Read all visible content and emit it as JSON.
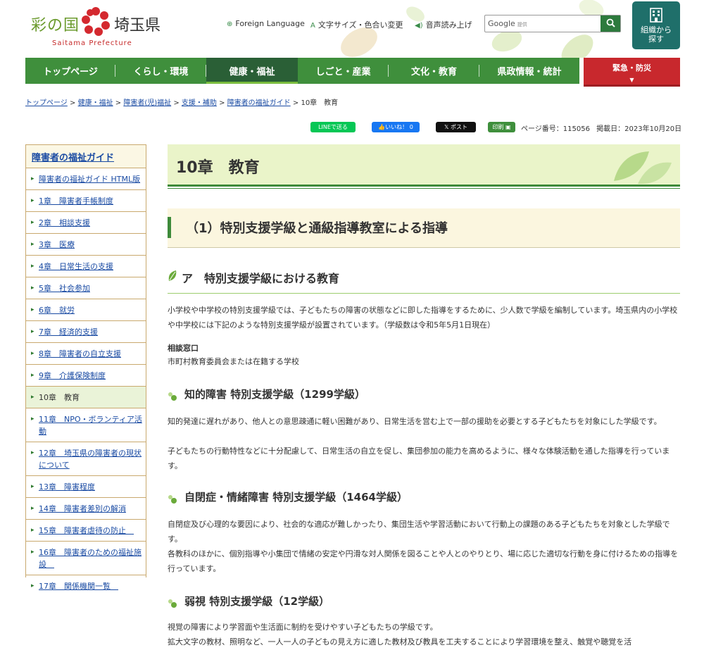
{
  "header": {
    "logo": {
      "sai": "彩の国",
      "pref": "埼玉県",
      "sub": "Saitama Prefecture"
    },
    "utilities": [
      "Foreign Language",
      "文字サイズ・色合い変更",
      "音声読み上げ"
    ],
    "search": {
      "brand": "Google",
      "brand_sub": "提供",
      "placeholder": ""
    },
    "org_button": {
      "line1": "組織から",
      "line2": "探す"
    }
  },
  "nav": {
    "items": [
      "トップページ",
      "くらし・環境",
      "健康・福祉",
      "しごと・産業",
      "文化・教育",
      "県政情報・統計"
    ],
    "active_index": 2,
    "emergency": "緊急・防災"
  },
  "breadcrumb": {
    "links": [
      "トップページ",
      "健康・福祉",
      "障害者(児)福祉",
      "支援・補助",
      "障害者の福祉ガイド"
    ],
    "separator": ">",
    "current": "10章　教育"
  },
  "share": {
    "line": "LINEで送る",
    "like": "いいね！ 0",
    "x_post": "ポスト",
    "print": "印刷",
    "page_number": "ページ番号：115056",
    "posted": "掲載日：2023年10月20日"
  },
  "sidebar": {
    "title": "障害者の福祉ガイド",
    "items": [
      "障害者の福祉ガイド HTML版",
      "1章　障害者手帳制度",
      "2章　相談支援",
      "3章　医療",
      "4章　日常生活の支援",
      "5章　社会参加",
      "6章　就労",
      "7章　経済的支援",
      "8章　障害者の自立支援",
      "9章　介護保険制度",
      "10章　教育",
      "11章　NPO・ボランティア活動",
      "12章　埼玉県の障害者の現状について",
      "13章　障害程度",
      "14章　障害者差別の解消",
      "15章　障害者虐待の防止　",
      "16章　障害者のための福祉施設　",
      "17章　関係機関一覧　"
    ],
    "current_index": 10
  },
  "main": {
    "h1": "10章　教育",
    "h2": "（1）特別支援学級と通級指導教室による指導",
    "h3": "ア　特別支援学級における教育",
    "intro": "小学校や中学校の特別支援学級では、子どもたちの障害の状態などに即した指導をするために、少人数で学級を編制しています。埼玉県内の小学校や中学校には下記のような特別支援学級が設置されています。（学級数は令和5年5月1日現在）",
    "consult_label": "相談窓口",
    "consult_text": "市町村教育委員会または在籍する学校",
    "sections": [
      {
        "title": "知的障害 特別支援学級（1299学級）",
        "p1": "知的発達に遅れがあり、他人との意思疎通に軽い困難があり、日常生活を営む上で一部の援助を必要とする子どもたちを対象にした学級です。",
        "p2": "子どもたちの行動特性などに十分配慮して、日常生活の自立を促し、集団参加の能力を高めるように、様々な体験活動を通した指導を行っています。"
      },
      {
        "title": "自閉症・情緒障害 特別支援学級（1464学級）",
        "p1": "自閉症及び心理的な要因により、社会的な適応が難しかったり、集団生活や学習活動において行動上の課題のある子どもたちを対象とした学級です。",
        "p2": "各教科のほかに、個別指導や小集団で情緒の安定や円滑な対人関係を図ることや人とのやりとり、場に応じた適切な行動を身に付けるための指導を行っています。"
      },
      {
        "title": "弱視 特別支援学級（12学級）",
        "p1": "視覚の障害により学習面や生活面に制約を受けやすい子どもたちの学級です。",
        "p2": "拡大文字の教材、照明など、一人一人の子どもの見え方に適した教材及び教具を工夫することにより学習環境を整え、触覚や聴覚を活"
      }
    ]
  },
  "colors": {
    "nav_green": "#3f8f3c",
    "nav_active": "#2a5f36",
    "emergency_red": "#c8282d",
    "link_blue": "#1a4ba3",
    "heading_bg": "#eaf4c9",
    "sidebar_border": "#c9a96e"
  }
}
